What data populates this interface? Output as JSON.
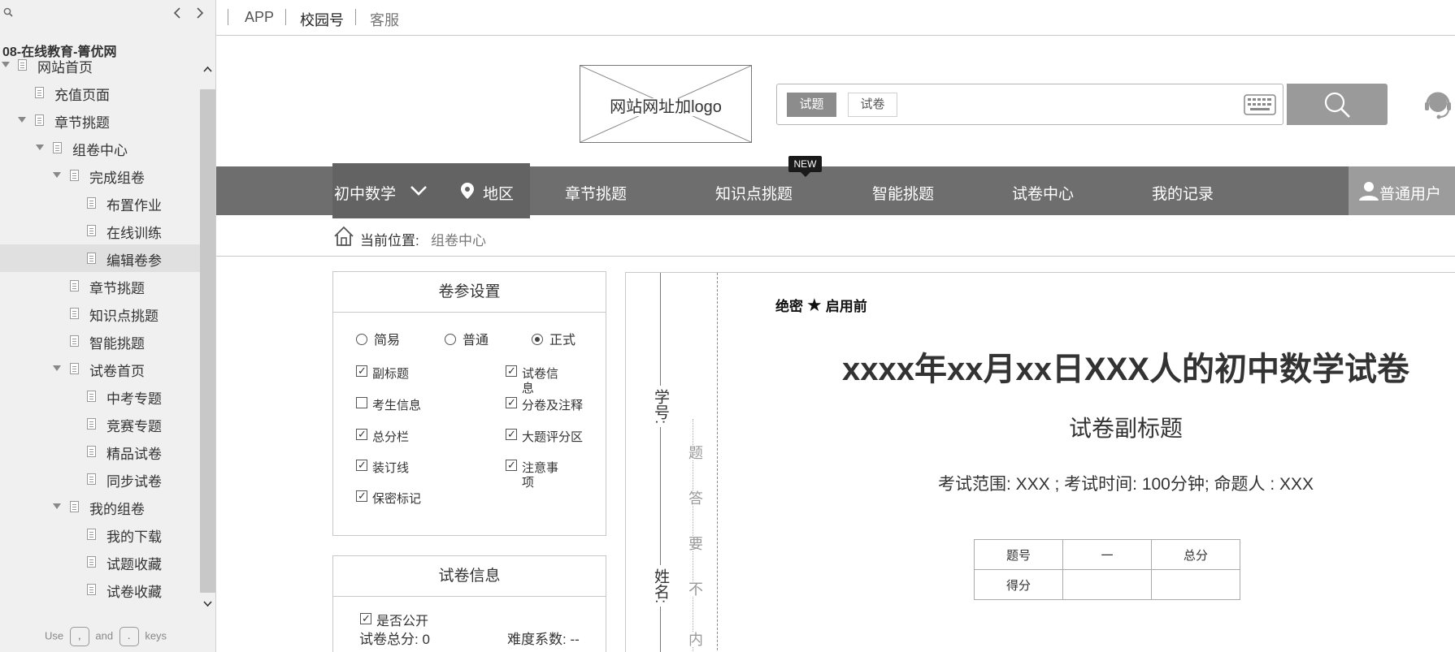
{
  "sidebar": {
    "project_title": "08-在线教育-箐优网",
    "search_icon": "search-icon",
    "hint": {
      "use": "Use",
      "and": "and",
      "keys": "keys",
      "key_prev": ",",
      "key_next": "."
    },
    "items": [
      {
        "label": "网站首页",
        "expanded": true
      },
      {
        "label": "充值页面"
      },
      {
        "label": "章节挑题",
        "expanded": true
      },
      {
        "label": "组卷中心",
        "expanded": true
      },
      {
        "label": "完成组卷",
        "expanded": true
      },
      {
        "label": "布置作业"
      },
      {
        "label": "在线训练"
      },
      {
        "label": "编辑卷参",
        "selected": true
      },
      {
        "label": "章节挑题"
      },
      {
        "label": "知识点挑题"
      },
      {
        "label": "智能挑题"
      },
      {
        "label": "试卷首页",
        "expanded": true
      },
      {
        "label": "中考专题"
      },
      {
        "label": "竞赛专题"
      },
      {
        "label": "精品试卷"
      },
      {
        "label": "同步试卷"
      },
      {
        "label": "我的组卷",
        "expanded": true
      },
      {
        "label": "我的下载"
      },
      {
        "label": "试题收藏"
      },
      {
        "label": "试卷收藏"
      }
    ]
  },
  "topbar": {
    "links": [
      "APP",
      "校园号",
      "客服"
    ]
  },
  "header": {
    "logo_text": "网站网址加logo",
    "search_tabs": [
      "试题",
      "试卷"
    ],
    "search_placeholder": ""
  },
  "nav": {
    "subject": "初中数学",
    "region": "地区",
    "items": [
      "章节挑题",
      "知识点挑题",
      "智能挑题",
      "试卷中心",
      "我的记录"
    ],
    "new_badge": "NEW",
    "user": "普通用户"
  },
  "breadcrumb": {
    "label": "当前位置:",
    "current": "组卷中心"
  },
  "settings_panel": {
    "title": "卷参设置",
    "modes": [
      {
        "label": "简易",
        "checked": false
      },
      {
        "label": "普通",
        "checked": false
      },
      {
        "label": "正式",
        "checked": true
      }
    ],
    "options": [
      {
        "label": "副标题",
        "checked": true
      },
      {
        "label": "试卷信息",
        "checked": true
      },
      {
        "label": "考生信息",
        "checked": false
      },
      {
        "label": "分卷及注释",
        "checked": true
      },
      {
        "label": "总分栏",
        "checked": true
      },
      {
        "label": "大题评分区",
        "checked": true
      },
      {
        "label": "装订线",
        "checked": true
      },
      {
        "label": "注意事项",
        "checked": true
      },
      {
        "label": "保密标记",
        "checked": true
      }
    ]
  },
  "info_panel": {
    "title": "试卷信息",
    "public_label": "是否公开",
    "public_checked": true,
    "total_score": "试卷总分: 0",
    "difficulty": "难度系数: --"
  },
  "paper": {
    "binding": {
      "student_no": "学号:",
      "name": "姓名:",
      "warning_chars": [
        "题",
        "答",
        "要",
        "不",
        "内"
      ]
    },
    "secret_prefix": "绝密",
    "secret_suffix": "启用前",
    "title": "xxxx年xx月xx日XXX人的初中数学试卷",
    "subtitle": "试卷副标题",
    "meta": "考试范围: XXX ; 考试时间: 100分钟; 命题人 : XXX",
    "score_table": {
      "header": [
        "题号",
        "一",
        "总分"
      ],
      "row": [
        "得分",
        "",
        ""
      ]
    }
  }
}
